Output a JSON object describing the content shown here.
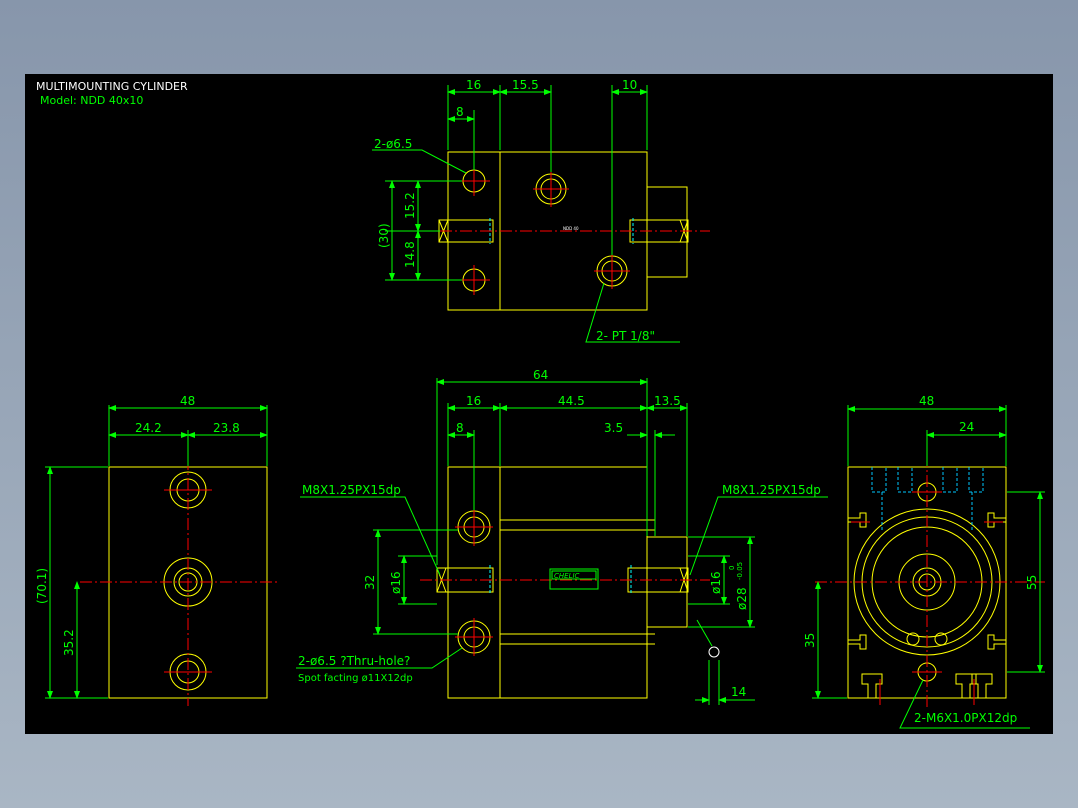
{
  "title": "MULTIMOUNTING CYLINDER",
  "model": "Model:  NDD 40x10",
  "top_view": {
    "dims": {
      "d16": "16",
      "d15_5": "15.5",
      "d10": "10",
      "d8": "8",
      "d15_2": "15.2",
      "d30": "(30)",
      "d14_8": "14.8"
    },
    "callouts": {
      "holes": "2-ø6.5",
      "port": "2-  PT 1/8\""
    },
    "small_label": "NDD 40"
  },
  "left_view": {
    "dims": {
      "d48": "48",
      "d24_2": "24.2",
      "d23_8": "23.8",
      "d70_1": "(70.1)",
      "d35_2": "35.2"
    }
  },
  "front_view": {
    "dims": {
      "d64": "64",
      "d16": "16",
      "d44_5": "44.5",
      "d13_5": "13.5",
      "d8": "8",
      "d3_5": "3.5",
      "d32": "32",
      "d16a": "ø16",
      "d16b": "ø16",
      "d28": "ø28",
      "d28_tol_hi": "0",
      "d28_tol_lo": "-0.05",
      "d14": "14"
    },
    "callouts": {
      "thread_left": "M8X1.25PX15dp",
      "thread_right": "M8X1.25PX15dp",
      "holes": "2-ø6.5 ?Thru-hole?",
      "spot": "Spot facting  ø11X12dp"
    },
    "logo": "CHELIC"
  },
  "right_view": {
    "dims": {
      "d48": "48",
      "d24": "24",
      "d55": "55",
      "d35": "35"
    },
    "callouts": {
      "thread": "2-M6X1.0PX12dp"
    }
  },
  "colors": {
    "dim": "#00ff00",
    "body": "#ffff00",
    "center": "#ff0000",
    "hidden": "#00c8ff",
    "text": "#ffffff"
  }
}
